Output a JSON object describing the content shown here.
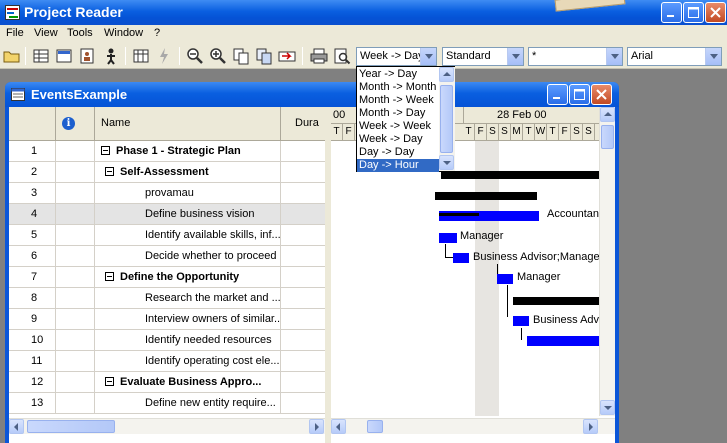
{
  "app": {
    "title": "Project Reader"
  },
  "menu": {
    "items": [
      {
        "label": "File"
      },
      {
        "label": "View"
      },
      {
        "label": "Tools"
      },
      {
        "label": "Window"
      },
      {
        "label": "?"
      }
    ]
  },
  "toolbar": {
    "timescale_value": "Week -> Day",
    "view_value": "Standard",
    "filter_value": "*",
    "font_value": "Arial"
  },
  "timescale_dropdown": {
    "options": [
      "Year -> Day",
      "Month -> Month",
      "Month -> Week",
      "Month -> Day",
      "Week -> Week",
      "Week -> Day",
      "Day -> Day",
      "Day -> Hour"
    ],
    "highlighted_index": 7
  },
  "child_window": {
    "title": "EventsExample"
  },
  "grid": {
    "headers": {
      "name": "Name",
      "duration": "Dura"
    },
    "rows": [
      {
        "id": "1",
        "name": "Phase 1 - Strategic Plan",
        "level": 0,
        "summary": true,
        "selected": false
      },
      {
        "id": "2",
        "name": "Self-Assessment",
        "level": 1,
        "summary": true,
        "selected": false
      },
      {
        "id": "3",
        "name": "provamau",
        "level": 2,
        "summary": false,
        "selected": false
      },
      {
        "id": "4",
        "name": "Define business vision",
        "level": 2,
        "summary": false,
        "selected": true
      },
      {
        "id": "5",
        "name": "Identify available skills, inf...",
        "level": 2,
        "summary": false,
        "selected": false
      },
      {
        "id": "6",
        "name": "Decide whether to proceed",
        "level": 2,
        "summary": false,
        "selected": false
      },
      {
        "id": "7",
        "name": "Define the Opportunity",
        "level": 1,
        "summary": true,
        "selected": false
      },
      {
        "id": "8",
        "name": "Research the market and ...",
        "level": 2,
        "summary": false,
        "selected": false
      },
      {
        "id": "9",
        "name": "Interview owners of similar...",
        "level": 2,
        "summary": false,
        "selected": false
      },
      {
        "id": "10",
        "name": "Identify needed resources",
        "level": 2,
        "summary": false,
        "selected": false
      },
      {
        "id": "11",
        "name": "Identify operating cost ele...",
        "level": 2,
        "summary": false,
        "selected": false
      },
      {
        "id": "12",
        "name": "Evaluate Business Appro...",
        "level": 1,
        "summary": true,
        "selected": false
      },
      {
        "id": "13",
        "name": "Define new entity require...",
        "level": 2,
        "summary": false,
        "selected": false
      }
    ]
  },
  "gantt": {
    "left_date_fragment": "00",
    "week_label": "28 Feb 00",
    "days": [
      "T",
      "F",
      "S",
      "S",
      "M",
      "T",
      "W",
      "T",
      "F",
      "S",
      "S"
    ],
    "visible_days_left": [
      "T",
      "F"
    ],
    "resource_labels": [
      "Accountant",
      "Manager",
      "Business Advisor;Manager",
      "Manager",
      "Business Adv"
    ]
  }
}
